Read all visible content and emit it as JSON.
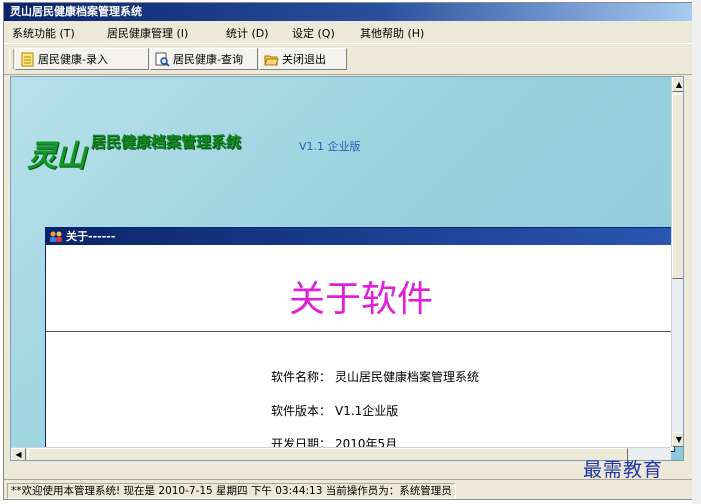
{
  "window": {
    "title": "灵山居民健康档案管理系统"
  },
  "menubar": {
    "items": [
      "系统功能 (T)",
      "居民健康管理 (I)",
      "统计 (D)",
      "设定 (Q)",
      "其他帮助 (H)"
    ]
  },
  "toolbar": {
    "buttons": [
      {
        "label": "居民健康-录入",
        "icon": "document-icon"
      },
      {
        "label": "居民健康-查询",
        "icon": "search-document-icon"
      },
      {
        "label": "关闭退出",
        "icon": "folder-exit-icon"
      }
    ]
  },
  "logo": {
    "big": "灵山",
    "rest": "居民健康档案管理系统",
    "version": "V1.1 企业版"
  },
  "about": {
    "title": "关于------",
    "heading": "关于软件",
    "info": [
      {
        "label": "软件名称：",
        "value": "灵山居民健康档案管理系统"
      },
      {
        "label": "软件版本：",
        "value": "V1.1企业版"
      },
      {
        "label": "开发日期：",
        "value": "2010年5月"
      }
    ]
  },
  "statusbar": {
    "text": "**欢迎使用本管理系统! 现在是  2010-7-15  星期四  下午 03:44:13  当前操作员为：系统管理员"
  },
  "watermark": "最需教育",
  "colors": {
    "titlebar": "#0a246a",
    "client_bg": "#9ad2df",
    "heading": "#e020d8",
    "logo_green": "#0f9a25"
  }
}
